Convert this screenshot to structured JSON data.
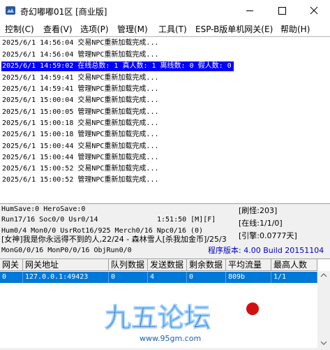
{
  "window": {
    "title": "奇幻嘟嘟01区 [商业版]"
  },
  "menu": [
    {
      "label": "控制(C)"
    },
    {
      "label": "查看(V)"
    },
    {
      "label": "选项(P)"
    },
    {
      "label": "管理(M)"
    },
    {
      "label": "工具(T)"
    },
    {
      "label": "ESP-B版单机网关(E)"
    },
    {
      "label": "帮助(H)"
    }
  ],
  "log": [
    "2025/6/1 14:56:04 交易NPC重新加载完成...",
    "2025/6/1 14:56:04 管理NPC重新加载完成...",
    "2025/6/1 14:59:02 在线总数: 1 真人数: 1 离线数: 0 假人数: 0",
    "2025/6/1 14:59:41 交易NPC重新加载完成...",
    "2025/6/1 14:59:41 管理NPC重新加载完成...",
    "2025/6/1 15:00:04 交易NPC重新加载完成...",
    "2025/6/1 15:00:05 管理NPC重新加载完成...",
    "2025/6/1 15:00:18 交易NPC重新加载完成...",
    "2025/6/1 15:00:18 管理NPC重新加载完成...",
    "2025/6/1 15:00:44 交易NPC重新加载完成...",
    "2025/6/1 15:00:44 管理NPC重新加载完成...",
    "2025/6/1 15:00:52 交易NPC重新加载完成...",
    "2025/6/1 15:00:52 管理NPC重新加载完成..."
  ],
  "status": {
    "save": "HumSave:0 HeroSave:0",
    "run": "Run17/16 Soc0/0 Usr0/14",
    "clock": "1:51:50 [M][F]",
    "refresh": "[刷怪:203]",
    "hum": "Hum0/4 Mon0/0 UsrRot16/925 Merch0/16 Npc0/16 (0)",
    "online": "[在线:1/1/0]",
    "notice": "[女神]我是你永远得不到的人,22/24 - 森林雪人[杀我加金币]/25/3",
    "engine": "[引擎:0.0777天]",
    "mon": "MonG0/0/16 MonP0/0/16 ObjRun0/0",
    "build": "程序版本: 4.00 Build 20151104"
  },
  "grid": {
    "headers": [
      "网关",
      "网关地址",
      "队列数据",
      "发送数据",
      "剩余数据",
      "平均流量",
      "最高人数"
    ],
    "rows": [
      [
        "0",
        "127.0.0.1:49423",
        "0",
        "4",
        "0",
        "809b",
        "1/1"
      ]
    ]
  },
  "watermark": {
    "brand": "九五论坛",
    "url": "www.95gm.com"
  }
}
